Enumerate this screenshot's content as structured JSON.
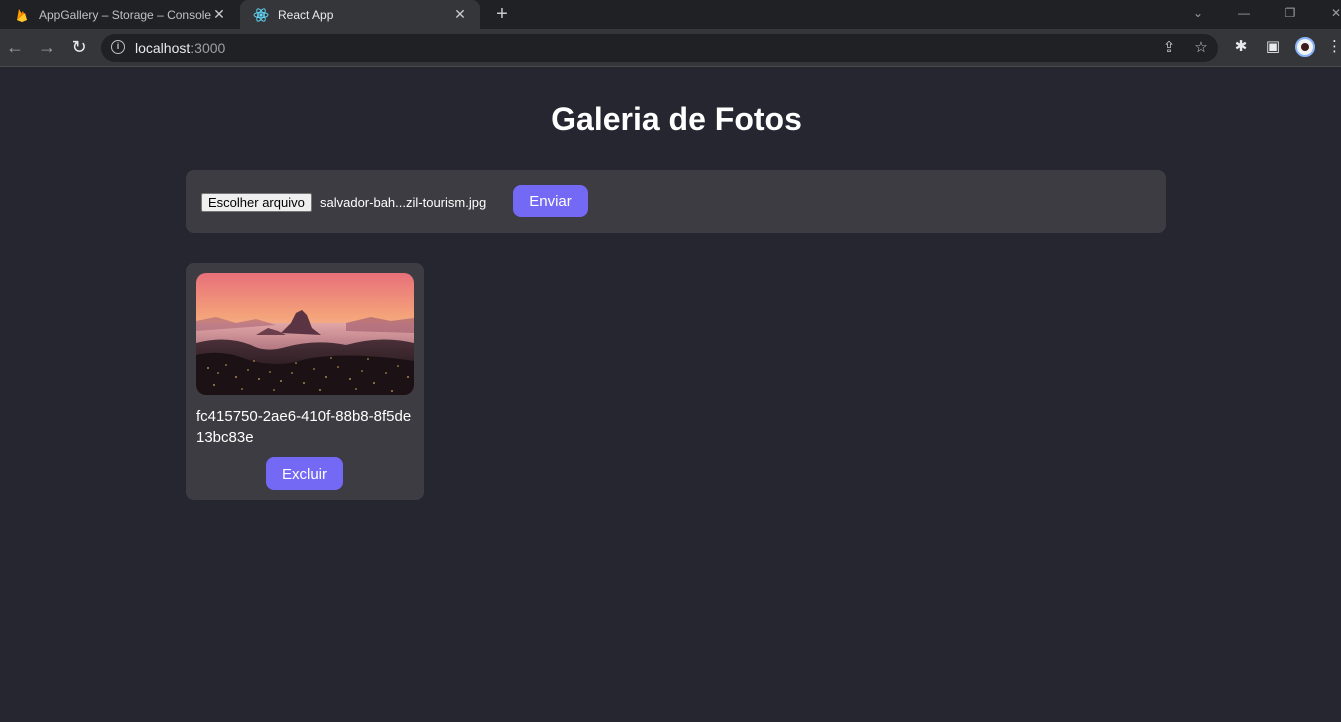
{
  "browser": {
    "tabs": [
      {
        "title": "AppGallery – Storage – Console do Firebase",
        "active": false,
        "icon": "firebase-icon"
      },
      {
        "title": "React App",
        "active": true,
        "icon": "react-icon"
      }
    ],
    "url_host": "localhost",
    "url_port": ":3000"
  },
  "app": {
    "title": "Galeria de Fotos",
    "upload": {
      "choose_file_label": "Escolher arquivo",
      "selected_file": "salvador-bah...zil-tourism.jpg",
      "send_label": "Enviar"
    },
    "photos": [
      {
        "name": "fc415750-2ae6-410f-88b8-8f5de13bc83e",
        "delete_label": "Excluir"
      }
    ]
  },
  "colors": {
    "background": "#262631",
    "panel": "#3c3c42",
    "accent": "#7469f5"
  }
}
